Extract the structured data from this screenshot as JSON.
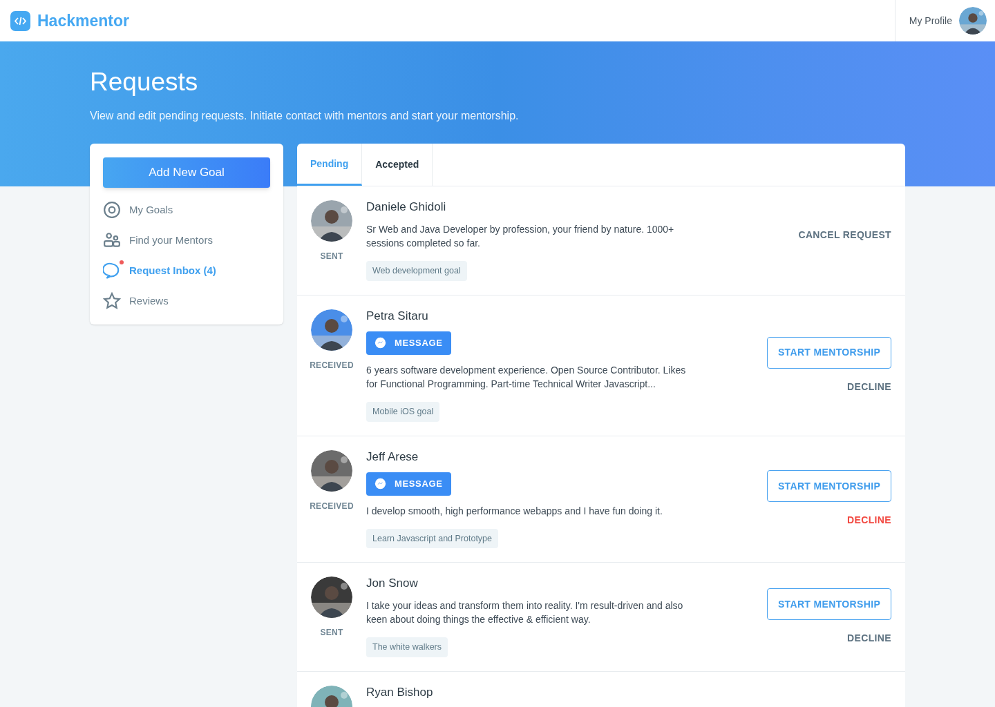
{
  "header": {
    "brand": "Hackmentor",
    "profile_label": "My Profile"
  },
  "hero": {
    "title": "Requests",
    "subtitle": "View and edit pending requests. Initiate contact with mentors and start your mentorship."
  },
  "sidebar": {
    "button": "Add New Goal",
    "items": [
      {
        "label": "My Goals",
        "selected": false,
        "unread": false
      },
      {
        "label": "Find your Mentors",
        "selected": false,
        "unread": false
      },
      {
        "label": "Request Inbox (4)",
        "selected": true,
        "unread": true
      },
      {
        "label": "Reviews",
        "selected": false,
        "unread": false
      }
    ]
  },
  "tabs": [
    {
      "label": "Pending",
      "selected": true
    },
    {
      "label": "Accepted",
      "selected": false
    }
  ],
  "requests": [
    {
      "name": "Daniele Ghidoli",
      "status": "SENT",
      "description": "Sr Web and Java Developer by profession, your friend by nature. 1000+ sessions completed so far.",
      "goal": "Web development goal",
      "actions": {
        "kind": "cancel",
        "cancel": "CANCEL REQUEST"
      }
    },
    {
      "name": "Petra Sitaru",
      "status": "RECEIVED",
      "message": "MESSAGE",
      "description": "6 years software development experience. Open Source Contributor. Likes for Functional Programming. Part-time Technical Writer Javascript...",
      "goal": "Mobile iOS goal",
      "actions": {
        "kind": "respond",
        "start": "START MENTORSHIP",
        "decline": "DECLINE",
        "decline_highlighted": false
      }
    },
    {
      "name": "Jeff Arese",
      "status": "RECEIVED",
      "message": "MESSAGE",
      "description": "I develop smooth, high performance webapps and I have fun doing it.",
      "goal": "Learn Javascript and Prototype",
      "actions": {
        "kind": "respond",
        "start": "START MENTORSHIP",
        "decline": "DECLINE",
        "decline_highlighted": true
      }
    },
    {
      "name": "Jon Snow",
      "status": "SENT",
      "description": "I take your ideas and transform them into reality. I'm result-driven and also keen about doing things the effective & efficient way.",
      "goal": "The white walkers",
      "actions": {
        "kind": "respond",
        "start": "START MENTORSHIP",
        "decline": "DECLINE",
        "decline_highlighted": false
      }
    },
    {
      "name": "Ryan Bishop"
    }
  ]
}
